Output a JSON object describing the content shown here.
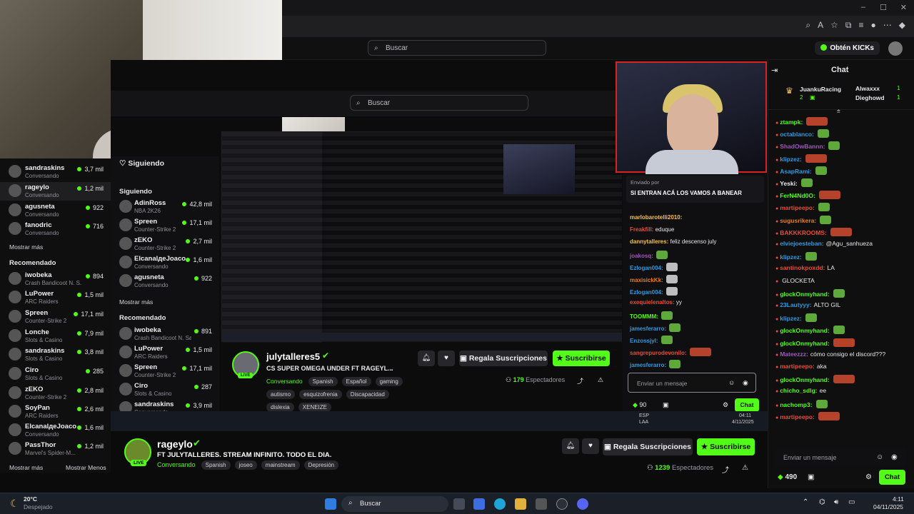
{
  "browser": {
    "search_placeholder": "Buscar",
    "kicks_label": "Obtén KICKs",
    "minimize": "–",
    "maximize": "☐",
    "close": "✕"
  },
  "left_sidebar": {
    "following": [
      {
        "name": "sandraskins",
        "sub": "Conversando",
        "viewers": "3,7 mil"
      },
      {
        "name": "rageylo",
        "sub": "Conversando",
        "viewers": "1,2 mil",
        "selected": true
      },
      {
        "name": "agusneta",
        "sub": "Conversando",
        "viewers": "922"
      },
      {
        "name": "fanodric",
        "sub": "Conversando",
        "viewers": "716"
      }
    ],
    "show_more": "Mostrar más",
    "recommended_title": "Recomendado",
    "recommended": [
      {
        "name": "iwobeka",
        "sub": "Crash Bandicoot N. S...",
        "viewers": "894"
      },
      {
        "name": "LuPower",
        "sub": "ARC Raiders",
        "viewers": "1,5 mil"
      },
      {
        "name": "Spreen",
        "sub": "Counter-Strike 2",
        "viewers": "17,1 mil"
      },
      {
        "name": "Lonche",
        "sub": "Slots & Casino",
        "viewers": "7,9 mil"
      },
      {
        "name": "sandraskins",
        "sub": "Slots & Casino",
        "viewers": "3,8 mil"
      },
      {
        "name": "Ciro",
        "sub": "Slots & Casino",
        "viewers": "285"
      },
      {
        "name": "zEKO",
        "sub": "Counter-Strike 2",
        "viewers": "2,8 mil"
      },
      {
        "name": "SoyPan",
        "sub": "ARC Raiders",
        "viewers": "2,6 mil"
      },
      {
        "name": "ElcanalдeJoaco",
        "sub": "Conversando",
        "viewers": "1,6 mil"
      },
      {
        "name": "PassThor",
        "sub": "Marvel's Spider-M...",
        "viewers": "1,2 mil"
      }
    ],
    "show_more_bottom": "Mostrar más",
    "show_less_bottom": "Mostrar Menos"
  },
  "inner": {
    "search_placeholder": "Buscar",
    "following_heading": "Siguiendo",
    "following_section": "Siguiendo",
    "following": [
      {
        "name": "AdinRoss",
        "sub": "NBA 2K26",
        "viewers": "42,8 mil"
      },
      {
        "name": "Spreen",
        "sub": "Counter-Strike 2",
        "viewers": "17,1 mil"
      },
      {
        "name": "zEKO",
        "sub": "Counter-Strike 2",
        "viewers": "2,7 mil"
      },
      {
        "name": "ElcanalдeJoaco",
        "sub": "Conversando",
        "viewers": "1,6 mil"
      },
      {
        "name": "agusneta",
        "sub": "Conversando",
        "viewers": "922"
      }
    ],
    "show_more": "Mostrar más",
    "recommended_title": "Recomendado",
    "recommended": [
      {
        "name": "iwobeka",
        "sub": "Crash Bandicoot N. Sa...",
        "viewers": "891"
      },
      {
        "name": "LuPower",
        "sub": "ARC Raiders",
        "viewers": "1,5 mil"
      },
      {
        "name": "Spreen",
        "sub": "Counter-Strike 2",
        "viewers": "17,1 mil"
      },
      {
        "name": "Ciro",
        "sub": "Slots & Casino",
        "viewers": "287"
      },
      {
        "name": "sandraskins",
        "sub": "Conversando",
        "viewers": "3,9 mil"
      }
    ],
    "stream": {
      "name": "julytalleres5",
      "title": "CS SUPER OMEGA UNDER FT RAGEYL...",
      "category": "Conversando",
      "tags": [
        "Spanish",
        "Español",
        "gaming",
        "autismo",
        "esquizofrenia",
        "Discapacidad",
        "dislexia",
        "XENEIZE"
      ],
      "live": "LIVE",
      "gift_label": "Regala Suscripciones",
      "subscribe_label": "Suscribirse",
      "viewers": "179",
      "viewers_label": "Espectadores"
    },
    "chat": {
      "pinned_by": "Enviado por",
      "pinned_text": "SI ENTRAN ACÁ LOS VAMOS A BANEAR",
      "messages": [
        {
          "user": "marlobarotelli2010:",
          "text": "",
          "color": "#f2c14e"
        },
        {
          "user": "Freakfill:",
          "text": "eduque",
          "color": "#e74c3c"
        },
        {
          "user": "dannytalleres:",
          "text": "feliz descenso july",
          "color": "#f2c14e"
        },
        {
          "user": "joakosq:",
          "text": "",
          "color": "#9b59b6"
        },
        {
          "user": "Ezlogan004:",
          "text": "",
          "color": "#3498db"
        },
        {
          "user": "maxisickKk:",
          "text": "",
          "color": "#e67e22"
        },
        {
          "user": "Ezlogan004:",
          "text": "",
          "color": "#3498db"
        },
        {
          "user": "exequielenaltos:",
          "text": "yy",
          "color": "#e74c3c"
        },
        {
          "user": "TOOMMM:",
          "text": "",
          "color": "#53fc18"
        },
        {
          "user": "jamesferarro:",
          "text": "",
          "color": "#3498db"
        },
        {
          "user": "Enzossjyl:",
          "text": "",
          "color": "#3498db"
        },
        {
          "user": "sangrepurodevonilo:",
          "text": "",
          "color": "#e74c3c"
        },
        {
          "user": "jamesferarro:",
          "text": "",
          "color": "#3498db"
        }
      ],
      "input_placeholder": "Enviar un mensaje",
      "points": "90",
      "send_label": "Chat"
    }
  },
  "main_stream": {
    "name": "rageylo",
    "title": "FT JULYTALLERES. STREAM INFINITO. TODO EL DIA.",
    "category": "Conversando",
    "tags": [
      "Spanish",
      "joseo",
      "mainstream",
      "Depresión"
    ],
    "live": "LIVE",
    "gift_label": "Regala Suscripciones",
    "subscribe_label": "Suscribirse",
    "viewers": "1239",
    "viewers_label": "Espectadores"
  },
  "chat": {
    "title": "Chat",
    "top_gifters": [
      {
        "name": "JuankuRacing",
        "count": "1"
      },
      {
        "name": "Alwaxxx",
        "count": "1"
      },
      {
        "name": "Dieghowd",
        "count": "1"
      },
      {
        "name": "",
        "count": "2"
      }
    ],
    "messages": [
      {
        "user": "ztampk:",
        "text": "",
        "color": "#53fc18"
      },
      {
        "user": "octablanco:",
        "text": "",
        "color": "#3498db"
      },
      {
        "user": "ShadOwBannn:",
        "text": "",
        "color": "#9b59b6"
      },
      {
        "user": "klipzez:",
        "text": "",
        "color": "#3498db"
      },
      {
        "user": "AsapRami:",
        "text": "",
        "color": "#3498db"
      },
      {
        "user": "Yeski:",
        "text": "",
        "color": "#e8e8ea"
      },
      {
        "user": "FerN4Nd0O:",
        "text": "",
        "color": "#53fc18"
      },
      {
        "user": "martipeepo:",
        "text": "",
        "color": "#e74c3c"
      },
      {
        "user": "sugusrikera:",
        "text": "",
        "color": "#e67e22"
      },
      {
        "user": "BAKKKROOMS:",
        "text": "",
        "color": "#e74c3c"
      },
      {
        "user": "elviejoesteban:",
        "text": "@Agu_sanhueza",
        "color": "#3498db"
      },
      {
        "user": "klipzez:",
        "text": "",
        "color": "#3498db"
      },
      {
        "user": "santinokpoxdd:",
        "text": "LA",
        "color": "#e74c3c"
      },
      {
        "user": "",
        "text": "GLOCKETA",
        "color": "#e8e8ea"
      },
      {
        "user": "glockOnmyhand:",
        "text": "",
        "color": "#53fc18"
      },
      {
        "user": "23Lautyyy:",
        "text": "ALTO GIL",
        "color": "#3498db"
      },
      {
        "user": "klipzez:",
        "text": "",
        "color": "#3498db"
      },
      {
        "user": "glockOnmyhand:",
        "text": "",
        "color": "#53fc18"
      },
      {
        "user": "glockOnmyhand:",
        "text": "",
        "color": "#53fc18"
      },
      {
        "user": "Mateezzz:",
        "text": "cómo consigo el discord???",
        "color": "#9b59b6"
      },
      {
        "user": "martipeepo:",
        "text": "aka",
        "color": "#e74c3c"
      },
      {
        "user": "glockOnmyhand:",
        "text": "",
        "color": "#53fc18"
      },
      {
        "user": "chicho_sdlg:",
        "text": "ee",
        "color": "#53fc18"
      },
      {
        "user": "nachomp3:",
        "text": "",
        "color": "#53fc18"
      },
      {
        "user": "martipeepo:",
        "text": "",
        "color": "#e74c3c"
      }
    ],
    "input_placeholder": "Enviar un mensaje",
    "points": "490",
    "send_label": "Chat"
  },
  "taskbar": {
    "weather_temp": "20°C",
    "weather_text": "Despejado",
    "search_label": "Buscar",
    "lang": "ESP",
    "lang2": "LAA",
    "time": "4:11",
    "date": "04/11/2025",
    "nested_time": "04:11",
    "nested_date": "4/11/2025",
    "nested_lang": "ESP",
    "nested_lang2": "LAA"
  }
}
